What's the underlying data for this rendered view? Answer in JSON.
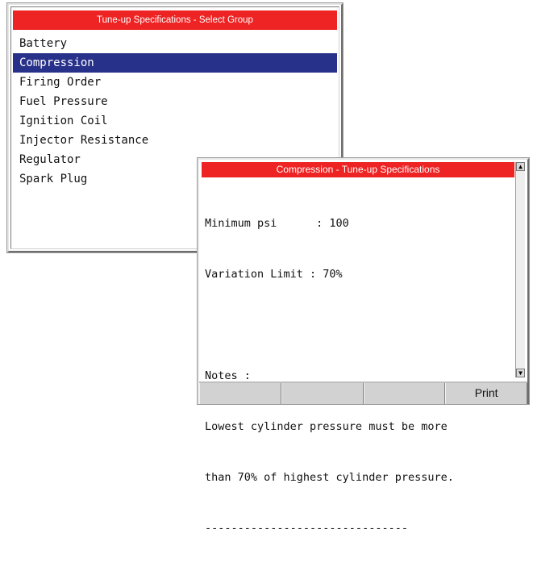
{
  "group_window": {
    "title": "Tune-up Specifications - Select Group",
    "items": [
      {
        "label": "Battery"
      },
      {
        "label": "Compression"
      },
      {
        "label": "Firing Order"
      },
      {
        "label": "Fuel Pressure"
      },
      {
        "label": "Ignition Coil"
      },
      {
        "label": "Injector Resistance"
      },
      {
        "label": "Regulator"
      },
      {
        "label": "Spark Plug"
      }
    ],
    "selected_index": 1
  },
  "spec_window": {
    "title": "Compression - Tune-up Specifications",
    "lines": [
      "Minimum psi      : 100",
      "Variation Limit : 70%",
      "",
      "Notes :",
      "Lowest cylinder pressure must be more",
      "than 70% of highest cylinder pressure.",
      "-------------------------------"
    ],
    "toolbar": [
      "",
      "",
      "",
      "Print"
    ]
  },
  "icons": {
    "scroll_up": "scroll-up-arrow-icon",
    "scroll_down": "scroll-down-arrow-icon"
  },
  "colors": {
    "title_bar": "#ee2323",
    "selection": "#27318a"
  }
}
